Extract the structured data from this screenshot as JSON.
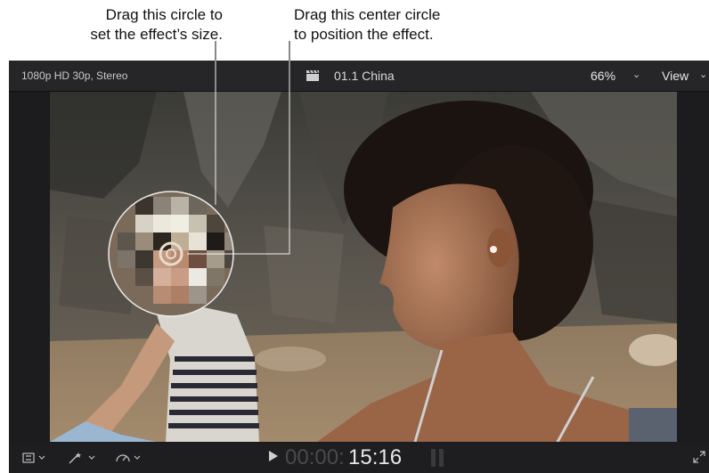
{
  "callouts": {
    "size": {
      "line1": "Drag this circle to",
      "line2": "set the effect’s size."
    },
    "position": {
      "line1": "Drag this center circle",
      "line2": "to position the effect."
    }
  },
  "viewer": {
    "format": "1080p HD 30p, Stereo",
    "clip_name": "01.1 China",
    "zoom": "66%",
    "view_menu": "View",
    "timecode_dim": "00:00:",
    "timecode_bright": "15:16"
  },
  "icons": [
    "clapper-icon",
    "chevron-down-icon",
    "transform-icon",
    "enhance-icon",
    "speed-icon",
    "play-icon",
    "fullscreen-icon"
  ]
}
